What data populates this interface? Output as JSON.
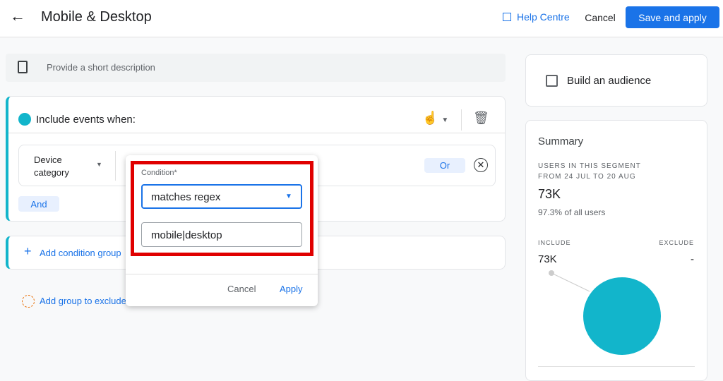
{
  "header": {
    "title": "Mobile & Desktop",
    "help": "Help Centre",
    "cancel": "Cancel",
    "save": "Save and apply"
  },
  "description": {
    "placeholder": "Provide a short description"
  },
  "include_group": {
    "title": "Include events when:",
    "dimension": "Device category",
    "or_label": "Or",
    "and_label": "And"
  },
  "add_condition_group": "Add condition group",
  "add_exclude_group": "Add group to exclude",
  "popup": {
    "label": "Condition*",
    "condition": "matches regex",
    "value": "mobile|desktop",
    "cancel": "Cancel",
    "apply": "Apply"
  },
  "audience": {
    "label": "Build an audience",
    "checked": false
  },
  "summary": {
    "title": "Summary",
    "users_label_1": "USERS IN THIS SEGMENT",
    "users_label_2": "FROM 24 JUL TO 20 AUG",
    "users": "73K",
    "percent": "97.3% of all users",
    "include_label": "INCLUDE",
    "include_value": "73K",
    "exclude_label": "EXCLUDE",
    "exclude_value": "-"
  },
  "colors": {
    "accent": "#1a73e8",
    "teal": "#12b5cb",
    "highlight": "#e00000"
  }
}
